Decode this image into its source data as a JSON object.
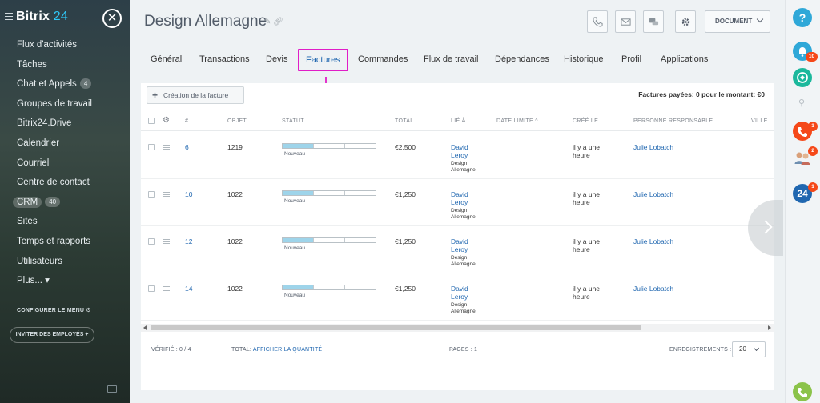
{
  "sidebar": {
    "logo_main": "Bitrix",
    "logo_num": "24",
    "close_glyph": "✕",
    "items": [
      {
        "label": "Flux d'activités",
        "count": ""
      },
      {
        "label": "Tâches",
        "count": ""
      },
      {
        "label": "Chat et Appels",
        "count": "4"
      },
      {
        "label": "Groupes de travail",
        "count": ""
      },
      {
        "label": "Bitrix24.Drive",
        "count": ""
      },
      {
        "label": "Calendrier",
        "count": ""
      },
      {
        "label": "Courriel",
        "count": ""
      },
      {
        "label": "Centre de contact",
        "count": ""
      },
      {
        "label": "CRM",
        "count": "40"
      },
      {
        "label": "Sites",
        "count": ""
      },
      {
        "label": "Temps et rapports",
        "count": ""
      },
      {
        "label": "Utilisateurs",
        "count": ""
      },
      {
        "label": "Plus... ▾",
        "count": ""
      }
    ],
    "config_label": "CONFIGURER LE MENU",
    "invite_label": "INVITER DES EMPLOYÉS +"
  },
  "header": {
    "title": "Design Allemagne",
    "document_label": "DOCUMENT"
  },
  "tabs": [
    {
      "label": "Général"
    },
    {
      "label": "Transactions"
    },
    {
      "label": "Devis"
    },
    {
      "label": "Factures"
    },
    {
      "label": "Commandes"
    },
    {
      "label": "Flux de travail"
    },
    {
      "label": "Dépendances"
    },
    {
      "label": "Historique"
    },
    {
      "label": "Profil"
    },
    {
      "label": "Applications"
    }
  ],
  "toolbar": {
    "create_label": "Création de la facture",
    "paid_summary": "Factures payées: 0 pour le montant: €0"
  },
  "table": {
    "columns": {
      "num": "#",
      "object": "OBJET",
      "status": "STATUT",
      "total": "TOTAL",
      "linked": "LIÉ À",
      "deadline": "DATE LIMITE ^",
      "created": "CRÉÉ LE",
      "responsible": "PERSONNE RESPONSABLE",
      "city": "VILLE"
    },
    "rows": [
      {
        "num": "6",
        "object": "1219",
        "status": "Nouveau",
        "progress": 0.33,
        "total": "€2,500",
        "contact_first": "David",
        "contact_last": "Leroy",
        "company1": "Design",
        "company2": "Allemagne",
        "created1": "il y a une",
        "created2": "heure",
        "responsible": "Julie Lobatch"
      },
      {
        "num": "10",
        "object": "1022",
        "status": "Nouveau",
        "progress": 0.33,
        "total": "€1,250",
        "contact_first": "David",
        "contact_last": "Leroy",
        "company1": "Design",
        "company2": "Allemagne",
        "created1": "il y a une",
        "created2": "heure",
        "responsible": "Julie Lobatch"
      },
      {
        "num": "12",
        "object": "1022",
        "status": "Nouveau",
        "progress": 0.33,
        "total": "€1,250",
        "contact_first": "David",
        "contact_last": "Leroy",
        "company1": "Design",
        "company2": "Allemagne",
        "created1": "il y a une",
        "created2": "heure",
        "responsible": "Julie Lobatch"
      },
      {
        "num": "14",
        "object": "1022",
        "status": "Nouveau",
        "progress": 0.33,
        "total": "€1,250",
        "contact_first": "David",
        "contact_last": "Leroy",
        "company1": "Design",
        "company2": "Allemagne",
        "created1": "il y a une",
        "created2": "heure",
        "responsible": "Julie Lobatch"
      }
    ]
  },
  "footer": {
    "verified": "VÉRIFIÉ : 0 / 4",
    "total_label": "TOTAL:",
    "total_link": "AFFICHER LA QUANTITÉ",
    "pages": "PAGES : 1",
    "records_label": "ENREGISTREMENTS :",
    "per_page": "20"
  },
  "rightbar": {
    "help_glyph": "?",
    "notif_count": "10",
    "call_count": "1",
    "people_count": "2",
    "b24_label": "24",
    "b24_count": "1"
  },
  "colors": {
    "accent_link": "#2067b0",
    "highlight_border": "#e01ec7",
    "progress_fill": "#9ed4ea",
    "badge_red": "#f54819"
  },
  "icons": {
    "title_edit": "pencil-icon",
    "title_link": "link-icon",
    "header_buttons": [
      "phone-icon",
      "mail-icon",
      "chat-icon",
      "gear-icon"
    ]
  }
}
